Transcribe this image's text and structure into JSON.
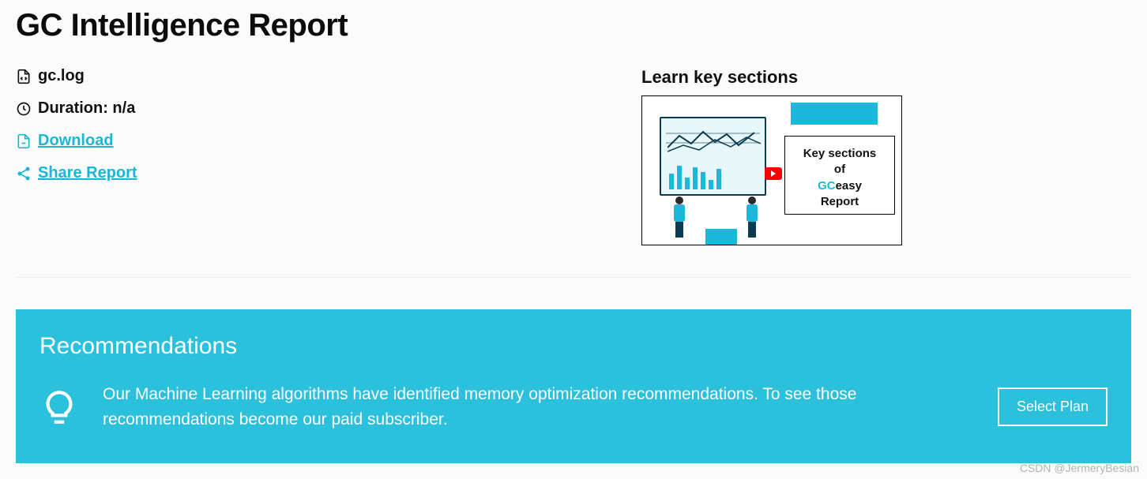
{
  "header": {
    "title": "GC Intelligence Report"
  },
  "meta": {
    "filename": "gc.log",
    "duration_label": "Duration: n/a",
    "download_label": "Download",
    "share_label": "Share Report"
  },
  "learn": {
    "heading": "Learn key sections",
    "card_line1": "Key sections",
    "card_line2": "of",
    "card_gc": "GC",
    "card_easy": "easy",
    "card_line4": "Report"
  },
  "recommendations": {
    "title": "Recommendations",
    "body": "Our Machine Learning algorithms have identified memory optimization recommendations. To see those recommendations become our paid subscriber.",
    "button": "Select Plan"
  },
  "watermark": "CSDN @JermeryBesian"
}
